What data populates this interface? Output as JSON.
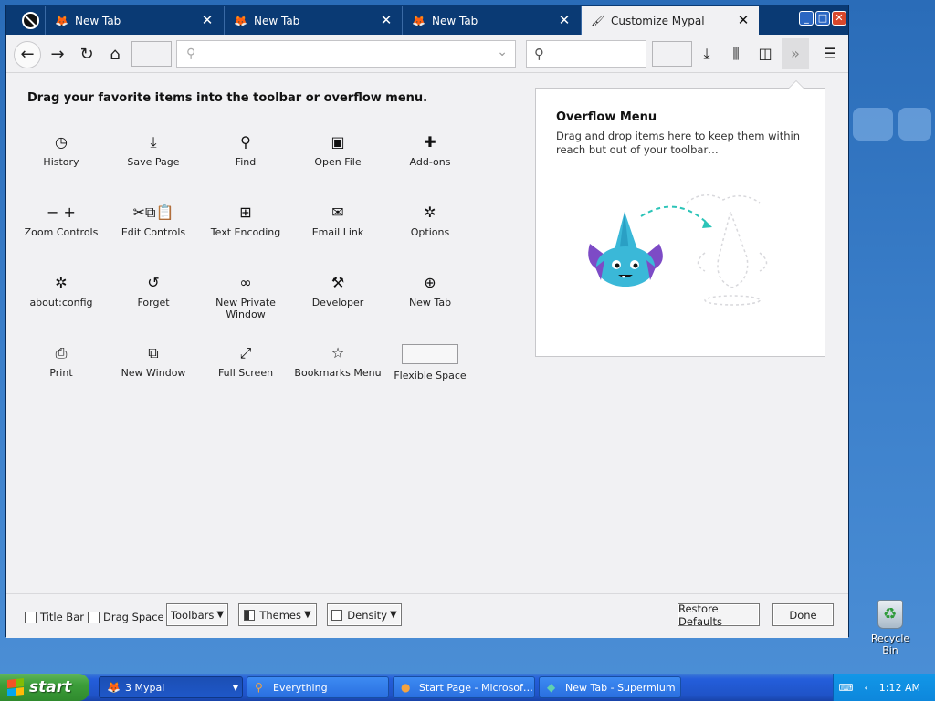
{
  "browser": {
    "tabs": [
      {
        "label": "New Tab",
        "active": false
      },
      {
        "label": "New Tab",
        "active": false
      },
      {
        "label": "New Tab",
        "active": false
      },
      {
        "label": "Customize Mypal",
        "active": true
      }
    ],
    "window_buttons": {
      "minimize": "_",
      "maximize": "□",
      "close": "✕"
    }
  },
  "customize": {
    "heading": "Drag your favorite items into the toolbar or overflow menu.",
    "items": [
      {
        "label": "History",
        "icon": "clock-icon",
        "glyph": "◷"
      },
      {
        "label": "Save Page",
        "icon": "save-page-icon",
        "glyph": "⤓"
      },
      {
        "label": "Find",
        "icon": "find-icon",
        "glyph": "⚲"
      },
      {
        "label": "Open File",
        "icon": "open-file-icon",
        "glyph": "▣"
      },
      {
        "label": "Add-ons",
        "icon": "puzzle-icon",
        "glyph": "✚"
      },
      {
        "label": "Zoom Controls",
        "icon": "zoom-icon",
        "glyph": "− +"
      },
      {
        "label": "Edit Controls",
        "icon": "edit-icon",
        "glyph": "✂⧉📋"
      },
      {
        "label": "Text Encoding",
        "icon": "encoding-icon",
        "glyph": "⊞"
      },
      {
        "label": "Email Link",
        "icon": "email-icon",
        "glyph": "✉"
      },
      {
        "label": "Options",
        "icon": "gear-icon",
        "glyph": "✲"
      },
      {
        "label": "about:config",
        "icon": "gear-icon",
        "glyph": "✲"
      },
      {
        "label": "Forget",
        "icon": "forget-icon",
        "glyph": "↺"
      },
      {
        "label": "New Private Window",
        "icon": "mask-icon",
        "glyph": "∞"
      },
      {
        "label": "Developer",
        "icon": "wrench-icon",
        "glyph": "⚒"
      },
      {
        "label": "New Tab",
        "icon": "new-tab-icon",
        "glyph": "⊕"
      },
      {
        "label": "Print",
        "icon": "print-icon",
        "glyph": "⎙"
      },
      {
        "label": "New Window",
        "icon": "new-window-icon",
        "glyph": "⧉"
      },
      {
        "label": "Full Screen",
        "icon": "fullscreen-icon",
        "glyph": "⤢"
      },
      {
        "label": "Bookmarks Menu",
        "icon": "bookmarks-icon",
        "glyph": "☆"
      },
      {
        "label": "Flexible Space",
        "icon": "flexible-space",
        "glyph": ""
      }
    ],
    "overflow": {
      "title": "Overflow Menu",
      "description": "Drag and drop items here to keep them within reach but out of your toolbar…"
    },
    "footer": {
      "title_bar": "Title Bar",
      "drag_space": "Drag Space",
      "toolbars": "Toolbars",
      "themes": "Themes",
      "density": "Density",
      "restore": "Restore Defaults",
      "done": "Done"
    }
  },
  "desktop": {
    "recycle_bin": "Recycle Bin"
  },
  "taskbar": {
    "start": "start",
    "tasks": [
      {
        "label": "3 Mypal",
        "active": true
      },
      {
        "label": "Everything",
        "active": false
      },
      {
        "label": "Start Page - Microsof…",
        "active": false
      },
      {
        "label": "New Tab - Supermium",
        "active": false
      }
    ],
    "clock": "1:12 AM"
  },
  "colors": {
    "accent": "#0c3c78",
    "content_bg": "#f1f1f3",
    "taskbar": "#245edb",
    "start": "#3c9e3a"
  }
}
